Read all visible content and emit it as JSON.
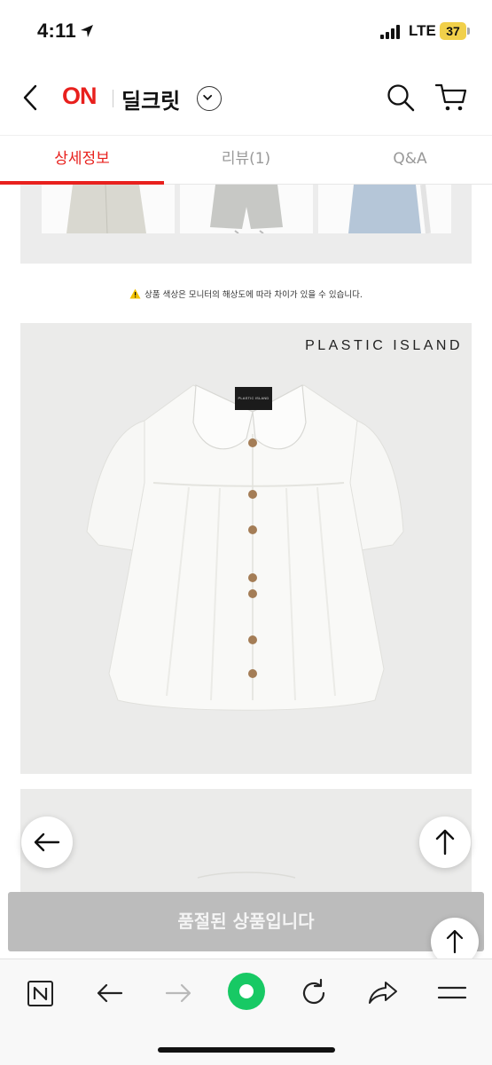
{
  "status_bar": {
    "time": "4:11",
    "network": "LTE",
    "battery": "37"
  },
  "header": {
    "logo": "ON",
    "title": "딜크릿"
  },
  "tabs": [
    {
      "label": "상세정보",
      "active": true
    },
    {
      "label": "리뷰(1)",
      "active": false
    },
    {
      "label": "Q&A",
      "active": false
    }
  ],
  "content": {
    "notice": "상품 색상은 모니터의 해상도에 따라 차이가 있을 수 있습니다.",
    "photo_brand": "PLASTIC ISLAND",
    "photo_label": "PLASTIC ISLAND"
  },
  "footer": {
    "soldout_label": "품절된 상품입니다"
  },
  "colors": {
    "accent": "#e8201d",
    "soldout_bg": "#bcbcbc",
    "browser_green": "#17c964"
  },
  "icons": [
    "location-arrow-icon",
    "back-chevron-icon",
    "chevron-down-icon",
    "search-icon",
    "cart-icon",
    "warning-icon",
    "arrow-left-icon",
    "arrow-up-icon",
    "naver-n-icon",
    "arrow-right-icon",
    "green-dot-icon",
    "refresh-icon",
    "share-icon",
    "menu-icon"
  ]
}
